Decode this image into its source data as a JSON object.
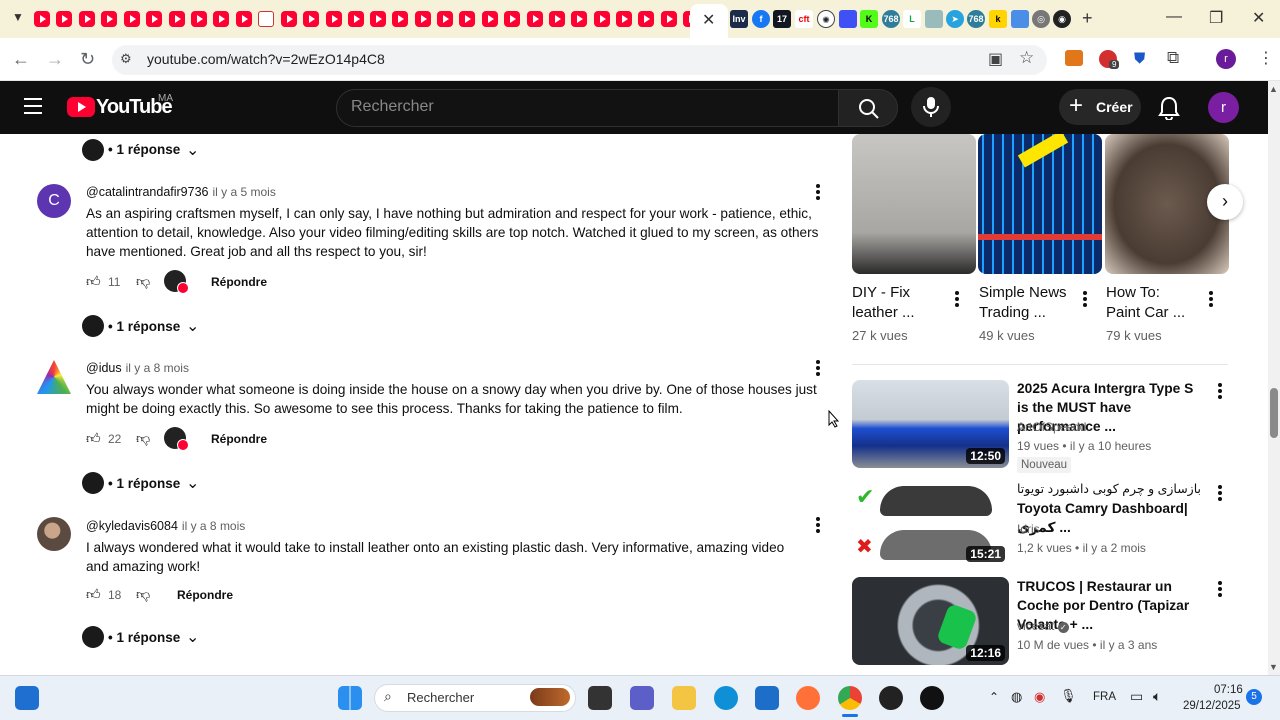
{
  "browser": {
    "url": "youtube.com/watch?v=2wEzO14p4C8",
    "extension_badge": "9",
    "profile_initial": "r"
  },
  "yt_header": {
    "logo_text": "YouTube",
    "country": "MA",
    "search_placeholder": "Rechercher",
    "create_label": "Créer",
    "avatar_initial": "r"
  },
  "comments": [
    {
      "author": "@catalintrandafir9736",
      "time": "il y a 5 mois",
      "avatar_letter": "C",
      "text": "As an aspiring craftsmen myself, I can only say, I have nothing but admiration and respect for your work - patience, ethic, attention to detail, knowledge. Also your video filming/editing skills are top notch. Watched it glued to my screen, as others have mentioned. Great job and all ths respect to you, sir!",
      "likes": "11",
      "reply_label": "Répondre",
      "replies_label": "1 réponse"
    },
    {
      "author": "@idus",
      "time": "il y a 8 mois",
      "avatar_letter": "",
      "text": "You always wonder what someone is doing inside the house on a snowy day when you drive by.  One of those houses just might be doing exactly this.  So awesome to see this process.  Thanks for taking the patience to film.",
      "likes": "22",
      "reply_label": "Répondre",
      "replies_label": "1 réponse"
    },
    {
      "author": "@kyledavis6084",
      "time": "il y a 8 mois",
      "avatar_letter": "",
      "text": "I always wondered what it would take to install leather onto an existing plastic dash. Very informative, amazing video and amazing work!",
      "likes": "18",
      "reply_label": "Répondre",
      "replies_label": "1 réponse"
    }
  ],
  "top_replies_label": "1 réponse",
  "shorts": [
    {
      "title_line1": "DIY - Fix",
      "title_line2": "leather ...",
      "views": "27 k vues"
    },
    {
      "title_line1": "Simple News",
      "title_line2": "Trading ...",
      "views": "49 k vues"
    },
    {
      "title_line1": "How To:",
      "title_line2": "Paint Car ...",
      "views": "79 k vues"
    }
  ],
  "videos": [
    {
      "title": "2025 Acura Intergra Type S is the MUST have performance ...",
      "channel": "ArtOfSpeedd",
      "meta": "19 vues  •  il y a 10 heures",
      "badge": "Nouveau",
      "duration": "12:50"
    },
    {
      "title_line1": "بازسازی و چرم کوبی داشبورد تویوتا",
      "title_line2": "Toyota Camry Dashboard|کمری ...",
      "channel": "Idris",
      "meta": "1,2 k vues  •  il y a 2 mois",
      "duration": "15:21"
    },
    {
      "title": "TRUCOS | Restaurar un Coche por Dentro (Tapizar Volante + ...",
      "channel": "vicesat",
      "meta": "10 M de vues  •  il y a 3 ans",
      "duration": "12:16"
    }
  ],
  "taskbar": {
    "search_label": "Rechercher",
    "language": "FRA",
    "time": "07:16",
    "date": "29/12/2025",
    "notification_count": "5"
  },
  "colors": {
    "yt_red": "#ff0033",
    "header_bg": "#0f0f0f",
    "tabstrip_bg": "#f6f1d9"
  }
}
